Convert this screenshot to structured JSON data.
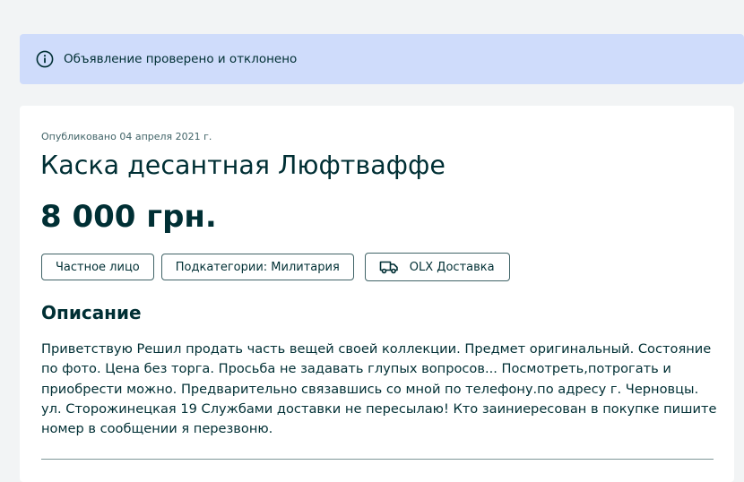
{
  "notice": {
    "text": "Объявление проверено и отклонено",
    "icon": "info-icon"
  },
  "listing": {
    "published": "Опубликовано 04 апреля 2021 г.",
    "title": "Каска десантная Люфтваффе",
    "price": "8 000 грн."
  },
  "tags": {
    "seller_type": "Частное лицо",
    "subcategory": "Подкатегории: Милитария",
    "delivery": "OLX Доставка",
    "delivery_icon": "truck-icon"
  },
  "description": {
    "heading": "Описание",
    "body": "Приветствую Решил продать часть вещей своей коллекции. Предмет оригинальный. Состояние по фото. Цена без торга. Просьба не задавать глупых вопросов... Посмотреть,потрогать и приобрести можно. Предварительно связавшись со мной по телефону.по адресу г. Черновцы. ул. Сторожинецкая 19 Службами доставки не пересылаю! Кто заиниересован в покупке пишите номер в сообщении я перезвоню."
  },
  "colors": {
    "background": "#f2f4f5",
    "notice_bg": "#cfdcfb",
    "text_primary": "#002f34",
    "border": "#406367"
  }
}
